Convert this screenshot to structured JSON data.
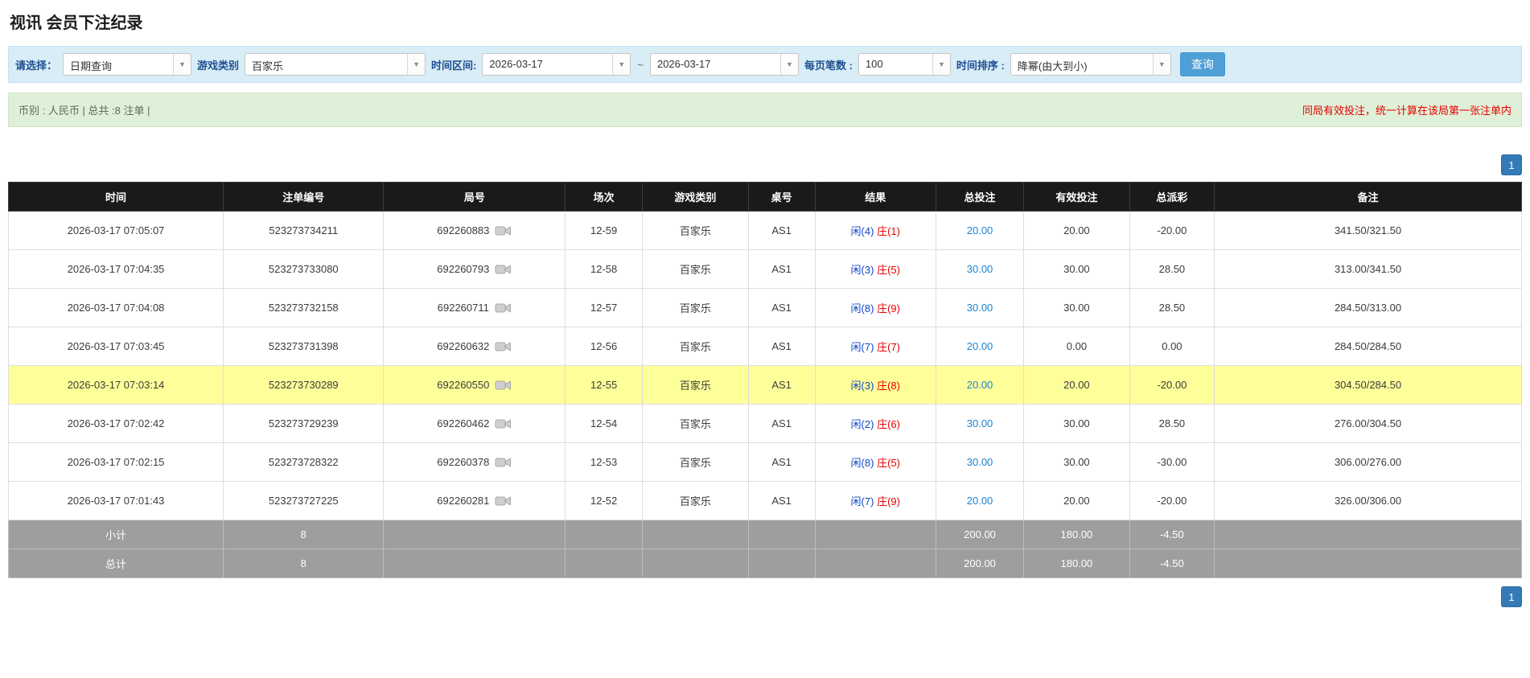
{
  "page": {
    "title": "视讯 会员下注纪录"
  },
  "filters": {
    "select_label": "请选择：",
    "select_value": "日期查询",
    "game_type_label": "游戏类别",
    "game_type_value": "百家乐",
    "time_range_label": "时间区间:",
    "date_from": "2026-03-17",
    "date_to": "2026-03-17",
    "tilde": "~",
    "page_size_label": "每页笔数 :",
    "page_size_value": "100",
    "sort_label": "时间排序 :",
    "sort_value": "降幂(由大到小)",
    "search_button": "查询"
  },
  "summary": {
    "left": "币别 : 人民币 | 总共 :8 注单 |",
    "right": "同局有效投注，统一计算在该局第一张注单内"
  },
  "pagination": {
    "page": "1"
  },
  "colors": {
    "header_bg": "#1a1a1a",
    "highlight_row": "#ffff99",
    "footer_bg": "#9e9e9e",
    "negative": "#e60000",
    "bet_link": "#1b82d2",
    "player_blue": "#1045c9",
    "banker_red": "#e60000",
    "search_button": "#4e9fd6",
    "pager": "#337ab7"
  },
  "table": {
    "headers": [
      "时间",
      "注单编号",
      "局号",
      "场次",
      "游戏类别",
      "桌号",
      "结果",
      "总投注",
      "有效投注",
      "总派彩",
      "备注"
    ],
    "rows": [
      {
        "time": "2026-03-17 07:05:07",
        "bet_id": "523273734211",
        "round_id": "692260883",
        "session": "12-59",
        "game": "百家乐",
        "table_no": "AS1",
        "result_player": "闲(4)",
        "result_banker": "庄(1)",
        "total_bet": "20.00",
        "valid_bet": "20.00",
        "payout": "-20.00",
        "note": "341.50/321.50",
        "highlight": false
      },
      {
        "time": "2026-03-17 07:04:35",
        "bet_id": "523273733080",
        "round_id": "692260793",
        "session": "12-58",
        "game": "百家乐",
        "table_no": "AS1",
        "result_player": "闲(3)",
        "result_banker": "庄(5)",
        "total_bet": "30.00",
        "valid_bet": "30.00",
        "payout": "28.50",
        "note": "313.00/341.50",
        "highlight": false
      },
      {
        "time": "2026-03-17 07:04:08",
        "bet_id": "523273732158",
        "round_id": "692260711",
        "session": "12-57",
        "game": "百家乐",
        "table_no": "AS1",
        "result_player": "闲(8)",
        "result_banker": "庄(9)",
        "total_bet": "30.00",
        "valid_bet": "30.00",
        "payout": "28.50",
        "note": "284.50/313.00",
        "highlight": false
      },
      {
        "time": "2026-03-17 07:03:45",
        "bet_id": "523273731398",
        "round_id": "692260632",
        "session": "12-56",
        "game": "百家乐",
        "table_no": "AS1",
        "result_player": "闲(7)",
        "result_banker": "庄(7)",
        "total_bet": "20.00",
        "valid_bet": "0.00",
        "payout": "0.00",
        "note": "284.50/284.50",
        "highlight": false
      },
      {
        "time": "2026-03-17 07:03:14",
        "bet_id": "523273730289",
        "round_id": "692260550",
        "session": "12-55",
        "game": "百家乐",
        "table_no": "AS1",
        "result_player": "闲(3)",
        "result_banker": "庄(8)",
        "total_bet": "20.00",
        "valid_bet": "20.00",
        "payout": "-20.00",
        "note": "304.50/284.50",
        "highlight": true
      },
      {
        "time": "2026-03-17 07:02:42",
        "bet_id": "523273729239",
        "round_id": "692260462",
        "session": "12-54",
        "game": "百家乐",
        "table_no": "AS1",
        "result_player": "闲(2)",
        "result_banker": "庄(6)",
        "total_bet": "30.00",
        "valid_bet": "30.00",
        "payout": "28.50",
        "note": "276.00/304.50",
        "highlight": false
      },
      {
        "time": "2026-03-17 07:02:15",
        "bet_id": "523273728322",
        "round_id": "692260378",
        "session": "12-53",
        "game": "百家乐",
        "table_no": "AS1",
        "result_player": "闲(8)",
        "result_banker": "庄(5)",
        "total_bet": "30.00",
        "valid_bet": "30.00",
        "payout": "-30.00",
        "note": "306.00/276.00",
        "highlight": false
      },
      {
        "time": "2026-03-17 07:01:43",
        "bet_id": "523273727225",
        "round_id": "692260281",
        "session": "12-52",
        "game": "百家乐",
        "table_no": "AS1",
        "result_player": "闲(7)",
        "result_banker": "庄(9)",
        "total_bet": "20.00",
        "valid_bet": "20.00",
        "payout": "-20.00",
        "note": "326.00/306.00",
        "highlight": false
      }
    ],
    "footer": [
      {
        "label": "小计",
        "count": "8",
        "total_bet": "200.00",
        "valid_bet": "180.00",
        "payout": "-4.50"
      },
      {
        "label": "总计",
        "count": "8",
        "total_bet": "200.00",
        "valid_bet": "180.00",
        "payout": "-4.50"
      }
    ]
  }
}
